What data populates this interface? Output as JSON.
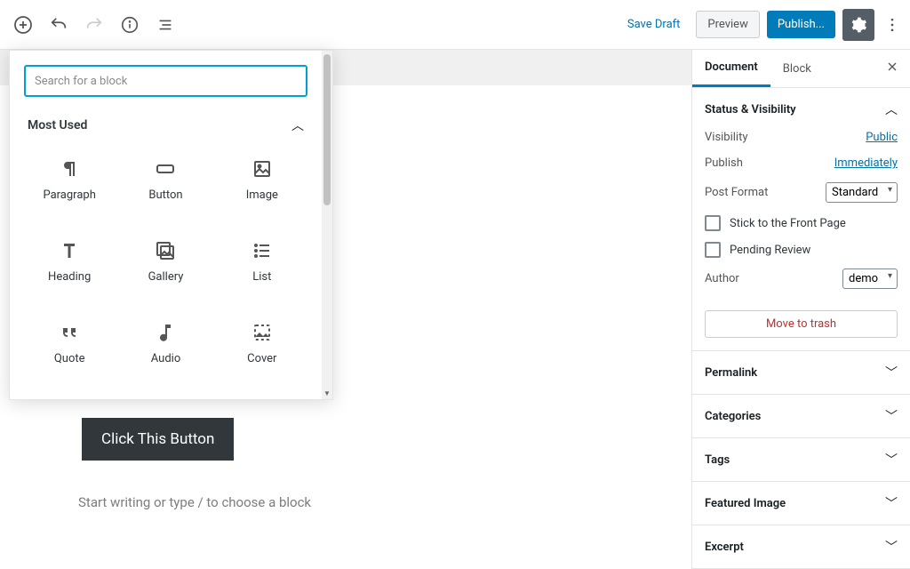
{
  "topbar": {
    "save_draft": "Save Draft",
    "preview": "Preview",
    "publish": "Publish..."
  },
  "inserter": {
    "search_placeholder": "Search for a block",
    "section_title": "Most Used",
    "blocks": [
      {
        "name": "Paragraph"
      },
      {
        "name": "Button"
      },
      {
        "name": "Image"
      },
      {
        "name": "Heading"
      },
      {
        "name": "Gallery"
      },
      {
        "name": "List"
      },
      {
        "name": "Quote"
      },
      {
        "name": "Audio"
      },
      {
        "name": "Cover"
      }
    ]
  },
  "canvas": {
    "button_text": "Click This Button",
    "placeholder": "Start writing or type / to choose a block"
  },
  "sidebar": {
    "tabs": {
      "document": "Document",
      "block": "Block"
    },
    "status": {
      "title": "Status & Visibility",
      "visibility_label": "Visibility",
      "visibility_value": "Public",
      "publish_label": "Publish",
      "publish_value": "Immediately",
      "post_format_label": "Post Format",
      "post_format_value": "Standard",
      "stick_front": "Stick to the Front Page",
      "pending_review": "Pending Review",
      "author_label": "Author",
      "author_value": "demo",
      "trash": "Move to trash"
    },
    "panels": {
      "permalink": "Permalink",
      "categories": "Categories",
      "tags": "Tags",
      "featured_image": "Featured Image",
      "excerpt": "Excerpt"
    }
  }
}
